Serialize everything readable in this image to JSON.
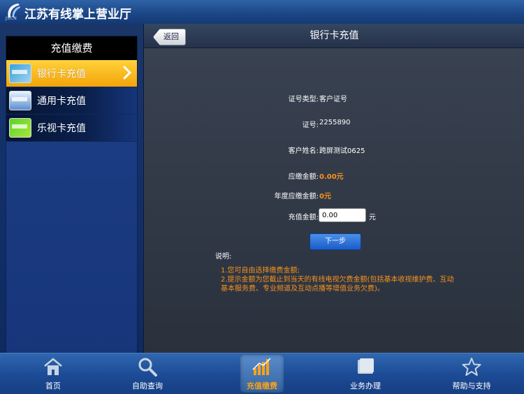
{
  "app": {
    "title": "江苏有线掌上营业厅",
    "logo_text": "JSCN"
  },
  "sidebar": {
    "header": "充值缴费",
    "items": [
      {
        "label": "银行卡充值",
        "active": true
      },
      {
        "label": "通用卡充值",
        "active": false
      },
      {
        "label": "乐视卡充值",
        "active": false
      }
    ]
  },
  "main": {
    "back_label": "返回",
    "title": "银行卡充值",
    "fields": [
      {
        "label": "证号类型:",
        "value": "客户证号"
      },
      {
        "label": "证号:",
        "value": "2255890"
      },
      {
        "label": "客户姓名:",
        "value": "跨屏测试0625"
      },
      {
        "label": "应缴金额:",
        "value": "0.00元"
      },
      {
        "label": "年度应缴金额:",
        "value": "0元"
      }
    ],
    "amount": {
      "label": "充值金额:",
      "value": "0.00",
      "unit": "元"
    },
    "next_label": "下一步",
    "notes_title": "说明:",
    "notes": [
      "1.您可自由选择缴费金额;",
      "2.提示金额为您截止到当天的有线电视欠费金额(包括基本收视维护费、互动",
      "基本服务费、专业频道及互动点播等增值业务欠费)。"
    ]
  },
  "tabs": [
    {
      "label": "首页",
      "icon": "home-icon"
    },
    {
      "label": "自助查询",
      "icon": "search-icon"
    },
    {
      "label": "充值缴费",
      "icon": "chart-icon",
      "active": true
    },
    {
      "label": "业务办理",
      "icon": "folder-icon"
    },
    {
      "label": "帮助与支持",
      "icon": "star-icon"
    }
  ],
  "colors": {
    "accent_orange": "#f7931e",
    "active_item": "#f3a40a"
  }
}
